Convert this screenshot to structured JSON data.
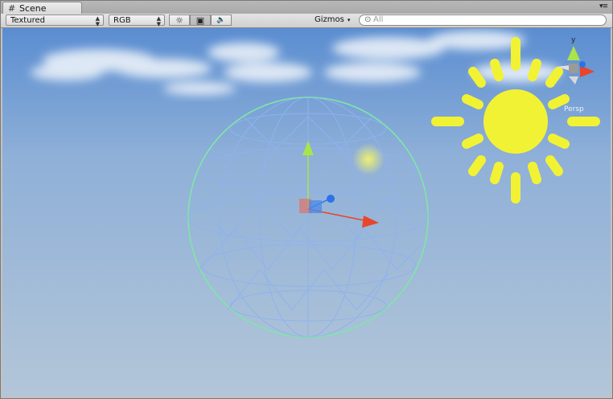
{
  "window": {
    "tab_label": "Scene",
    "tab_icon": "#",
    "menu_glyph": "▾≡"
  },
  "toolbar": {
    "render_mode": "Textured",
    "color_mode": "RGB",
    "gizmos_label": "Gizmos",
    "gizmos_caret": "▾",
    "lighting_glyph": "☼",
    "image_glyph": "▣",
    "audio_glyph": "🔈",
    "search_glyph": "⊙",
    "search_placeholder": "All"
  },
  "scene": {
    "orientation_gizmo": {
      "axis_up_label": "y",
      "projection_label": "Persp"
    },
    "colors": {
      "sky_top": "#5a8dd1",
      "sky_bottom": "#b3c6d8",
      "sphere_wire": "#8fb2ee",
      "sphere_outline": "#7fe6a8",
      "sun": "#f2f235",
      "axis_x": "#e8452a",
      "axis_y": "#a9e54a",
      "axis_z": "#2d73e8"
    }
  }
}
